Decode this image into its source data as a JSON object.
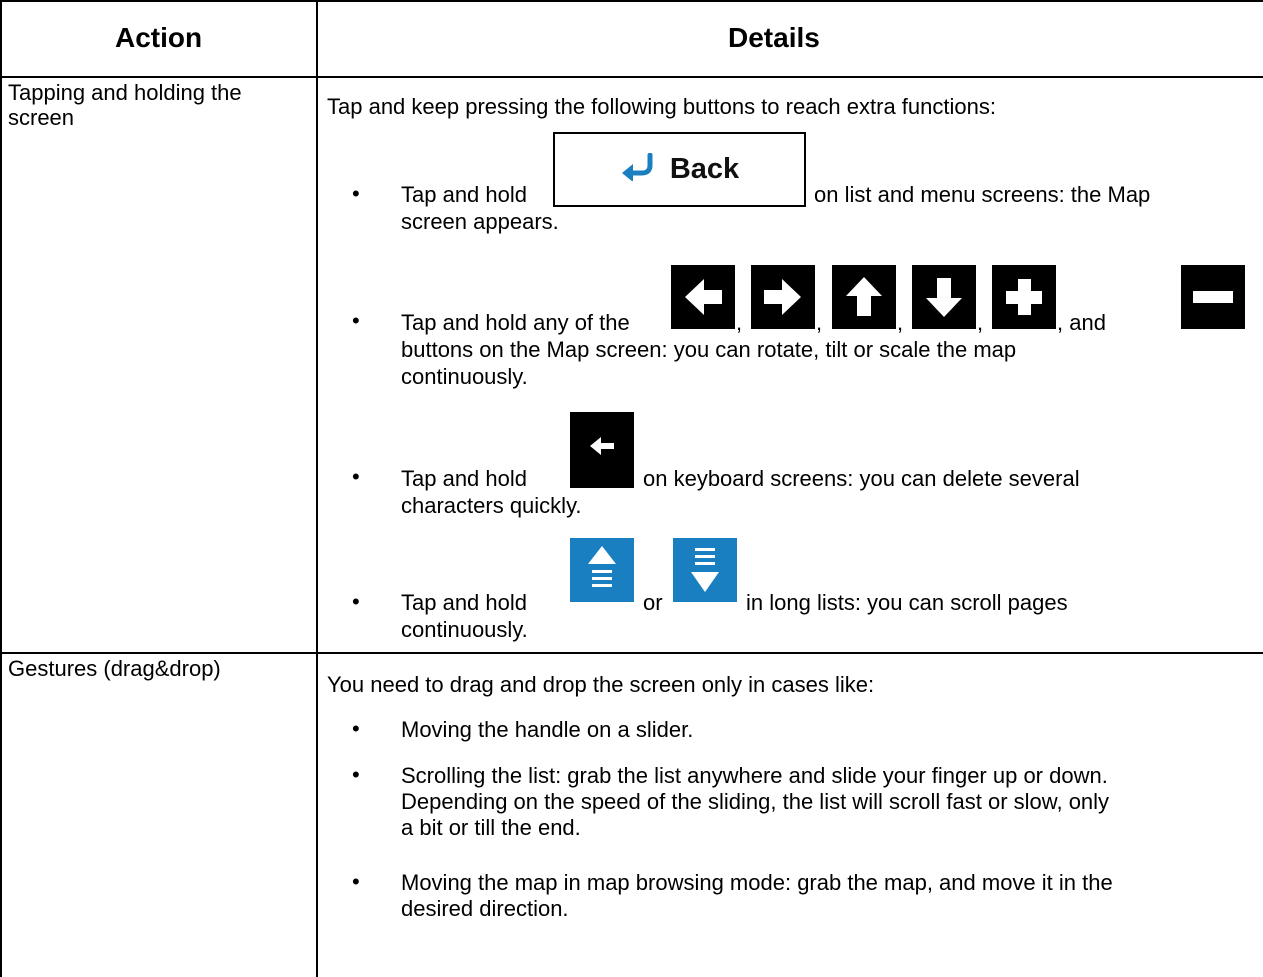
{
  "table": {
    "col_action": "Action",
    "col_details": "Details",
    "row1": {
      "action_line1": "Tapping and holding the",
      "action_line2": "screen",
      "intro": "Tap and keep pressing the following buttons to reach extra functions:",
      "back_label": "Back",
      "b1_pre": "Tap and hold",
      "b1_post": "on list and menu screens: the Map",
      "b1_line2": "screen appears.",
      "b2_pre": "Tap and hold any of the",
      "sep": ",",
      "b2_and": ", and",
      "b2_line2": "buttons on the Map screen: you can rotate, tilt or scale the map",
      "b2_line3": "continuously.",
      "b3_pre": "Tap and hold",
      "b3_post": "on keyboard screens: you can delete several",
      "b3_line2": "characters quickly.",
      "b4_pre": "Tap and hold",
      "b4_or": "or",
      "b4_post": "in long lists: you can scroll pages",
      "b4_line2": "continuously."
    },
    "row2": {
      "action": "Gestures (drag&drop)",
      "intro": "You need to drag and drop the screen only in cases like:",
      "c1": "Moving the handle on a slider.",
      "c2_line1": "Scrolling the list: grab the list anywhere and slide your finger up or down.",
      "c2_line2": "Depending on the speed of the sliding, the list will scroll fast or slow, only",
      "c2_line3": "a bit or till the end.",
      "c3_line1": "Moving the map in map browsing mode: grab the map, and move it in the",
      "c3_line2": "desired direction."
    }
  },
  "colors": {
    "icon_dark": "#000000",
    "icon_blue": "#1a7fc0",
    "back_arrow": "#1a7fc0"
  },
  "icons": [
    "back-arrow-icon",
    "arrow-left-icon",
    "arrow-right-icon",
    "arrow-up-icon",
    "arrow-down-icon",
    "plus-icon",
    "minus-icon",
    "backspace-icon",
    "page-up-icon",
    "page-down-icon"
  ]
}
